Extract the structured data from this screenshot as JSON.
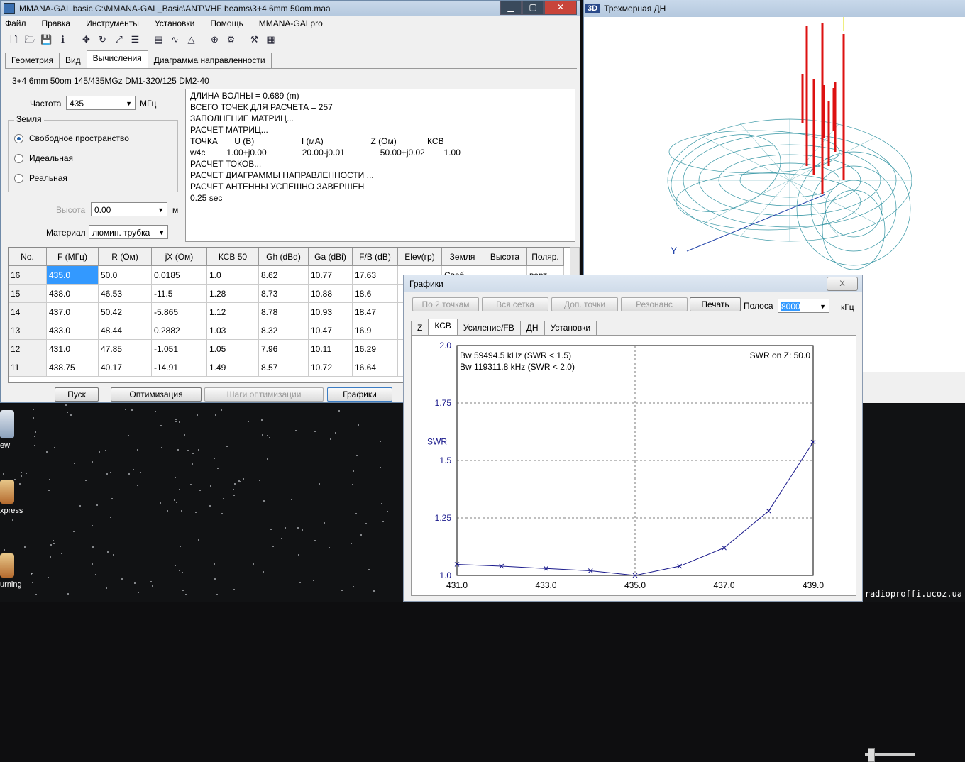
{
  "main_window": {
    "title": "MMANA-GAL basic C:\\MMANA-GAL_Basic\\ANT\\VHF beams\\3+4 6mm 50om.maa",
    "menu": [
      "Файл",
      "Правка",
      "Инструменты",
      "Установки",
      "Помощь",
      "MMANA-GALpro"
    ],
    "tabs": [
      "Геометрия",
      "Вид",
      "Вычисления",
      "Диаграмма направленности"
    ],
    "description": "3+4 6mm 50om 145/435MGz DM1-320/125  DM2-40",
    "freq_label": "Частота",
    "freq_value": "435",
    "freq_unit": "МГц",
    "ground_title": "Земля",
    "ground_options": [
      "Свободное пространство",
      "Идеальная",
      "Реальная"
    ],
    "height_label": "Высота",
    "height_value": "0.00",
    "height_unit": "м",
    "material_label": "Материал",
    "material_value": "люмин. трубка",
    "log": [
      "ДЛИНА ВОЛНЫ = 0.689 (m)",
      "ВСЕГО ТОЧЕК ДЛЯ РАСЧЕТА = 257",
      "ЗАПОЛНЕНИЕ МАТРИЦ...",
      "РАСЧЕТ МАТРИЦ...",
      "ТОЧКА       U (В)                    I (мА)                    Z (Ом)             КСВ",
      "w4c         1.00+j0.00               20.00-j0.01               50.00+j0.02        1.00",
      "РАСЧЕТ ТОКОВ...",
      "РАСЧЕТ ДИАГРАММЫ НАПРАВЛЕННОСТИ ...",
      "РАСЧЕТ АНТЕННЫ УСПЕШНО ЗАВЕРШЕН",
      "0.25 sec"
    ],
    "table_headers": [
      "No.",
      "F (МГц)",
      "R (Ом)",
      "jX (Ом)",
      "КСВ 50",
      "Gh (dBd)",
      "Ga (dBi)",
      "F/B (dB)",
      "Elev(гр)",
      "Земля",
      "Высота",
      "Поляр."
    ],
    "table_rows": [
      [
        "16",
        "435.0",
        "50.0",
        "0.0185",
        "1.0",
        "8.62",
        "10.77",
        "17.63",
        "",
        "Своб.",
        "",
        "верт."
      ],
      [
        "15",
        "438.0",
        "46.53",
        "-11.5",
        "1.28",
        "8.73",
        "10.88",
        "18.6",
        "",
        "",
        "",
        ""
      ],
      [
        "14",
        "437.0",
        "50.42",
        "-5.865",
        "1.12",
        "8.78",
        "10.93",
        "18.47",
        "",
        "",
        "",
        ""
      ],
      [
        "13",
        "433.0",
        "48.44",
        "0.2882",
        "1.03",
        "8.32",
        "10.47",
        "16.9",
        "",
        "",
        "",
        ""
      ],
      [
        "12",
        "431.0",
        "47.85",
        "-1.051",
        "1.05",
        "7.96",
        "10.11",
        "16.29",
        "",
        "",
        "",
        ""
      ],
      [
        "11",
        "438.75",
        "40.17",
        "-14.91",
        "1.49",
        "8.57",
        "10.72",
        "16.64",
        "",
        "",
        "",
        ""
      ]
    ],
    "buttons": [
      "Пуск",
      "Оптимизация",
      "Шаги оптимизации",
      "Графики"
    ]
  },
  "window_3d": {
    "title": "Трехмерная ДН",
    "icon_text": "3D",
    "axis_label": "Y"
  },
  "graph_window": {
    "title": "Графики",
    "close_label": "X",
    "buttons": [
      "По 2 точкам",
      "Вся сетка",
      "Доп. точки",
      "Резонанс",
      "Печать"
    ],
    "band_label": "Полоса",
    "band_value": "8000",
    "band_unit": "кГц",
    "tabs": [
      "Z",
      "КСВ",
      "Усиление/FB",
      "ДН",
      "Установки"
    ]
  },
  "chart_data": {
    "type": "line",
    "ylabel": "SWR",
    "xlabel": "",
    "annotations": [
      "Bw 59494.5 kHz (SWR < 1.5)",
      "Bw 119311.8 kHz (SWR < 2.0)",
      "SWR on Z: 50.0"
    ],
    "xlim": [
      431.0,
      439.0
    ],
    "ylim": [
      1.0,
      2.0
    ],
    "x_ticks": [
      "431.0",
      "433.0",
      "435.0",
      "437.0",
      "439.0"
    ],
    "y_ticks": [
      "2.0",
      "1.75",
      "1.5",
      "1.25",
      "1.0"
    ],
    "grid": true,
    "series": [
      {
        "x": [
          431.0,
          432.0,
          433.0,
          434.0,
          435.0,
          436.0,
          437.0,
          438.0,
          439.0
        ],
        "values": [
          1.048,
          1.04,
          1.03,
          1.02,
          1.0,
          1.04,
          1.12,
          1.28,
          1.58
        ]
      }
    ],
    "line_color": "#1a1a8c"
  },
  "desktop": {
    "icon_labels": [
      "ew",
      "xpress",
      "urning"
    ],
    "watermark": "radioproffi.ucoz.ua"
  }
}
